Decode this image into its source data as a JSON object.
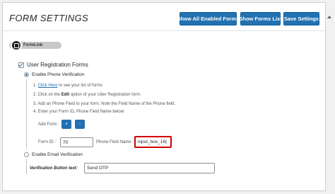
{
  "header": {
    "title": "FORM SETTINGS",
    "buttons": {
      "show_all_enabled_forms": "Show All Enabled Forms",
      "show_forms_list": "Show Forms List",
      "save_settings": "Save Settings"
    }
  },
  "brand": {
    "name": "FormLink"
  },
  "user_registration": {
    "label": "User Registration Forms",
    "checked": true,
    "phone_verification": {
      "label": "Enable Phone Verification",
      "selected": true,
      "steps": {
        "s1_number": "1.",
        "s1_link": "Click Here",
        "s1_text": " to see your list of forms",
        "s2_pre": "2. Click on the ",
        "s2_bold": "Edit",
        "s2_post": " option of your Uder Registration form.",
        "s3": "3. Add an Phone Field to your form. Note the Field Name of the Phone field.",
        "s4": "4. Enter your Form ID, Phone Field Name below:"
      },
      "add_form_label": "Add Form :",
      "add_symbol": "+",
      "remove_symbol": "-",
      "form_id_label": "Form ID :",
      "form_id_value": "70",
      "phone_field_label": "Phone Field Name :",
      "phone_field_value": "input_box_16("
    },
    "email_verification": {
      "label": "Enable Email Verification",
      "selected": false
    },
    "verification_button_label": "Verification Button text:",
    "verification_button_value": "Send OTP"
  }
}
